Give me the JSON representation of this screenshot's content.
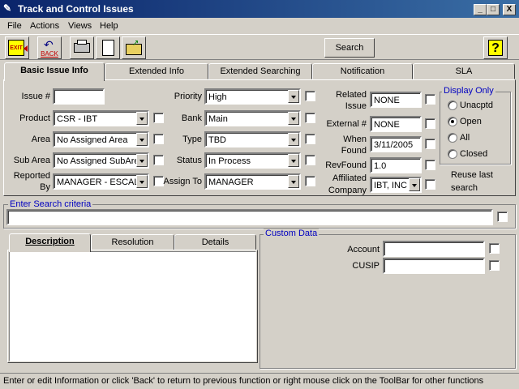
{
  "window": {
    "title": "Track and Control Issues",
    "minimize": "_",
    "maximize": "□",
    "close": "X"
  },
  "menu": [
    "File",
    "Actions",
    "Views",
    "Help"
  ],
  "toolbar": {
    "exit_label": "EXIT",
    "back_label": "BACK",
    "search_label": "Search",
    "help_label": "?"
  },
  "tabs": [
    "Basic Issue Info",
    "Extended Info",
    "Extended Searching",
    "Notification",
    "SLA"
  ],
  "form": {
    "issue_label": "Issue #",
    "issue_value": "",
    "product_label": "Product",
    "product_value": "CSR - IBT",
    "area_label": "Area",
    "area_value": "No Assigned Area",
    "subarea_label": "Sub Area",
    "subarea_value": "No Assigned SubArea",
    "reported_label_1": "Reported",
    "reported_label_2": "By",
    "reported_value": "MANAGER - ESCALA",
    "priority_label": "Priority",
    "priority_value": "High",
    "bank_label": "Bank",
    "bank_value": "Main",
    "type_label": "Type",
    "type_value": "TBD",
    "status_label": "Status",
    "status_value": "In Process",
    "assign_label": "Assign To",
    "assign_value": "MANAGER",
    "related_label_1": "Related",
    "related_label_2": "Issue",
    "related_value": "NONE",
    "external_label": "External #",
    "external_value": "NONE",
    "when_label_1": "When",
    "when_label_2": "Found",
    "when_value": "3/11/2005",
    "revfound_label": "RevFound",
    "revfound_value": "1.0",
    "affiliated_label_1": "Affiliated",
    "affiliated_label_2": "Company",
    "affiliated_value": "IBT, INC"
  },
  "display_only": {
    "title": "Display Only",
    "options": [
      "Unacptd",
      "Open",
      "All",
      "Closed"
    ],
    "selected": "Open"
  },
  "reuse": {
    "line1": "Reuse last",
    "line2": "search"
  },
  "search_criteria": {
    "title": "Enter Search criteria",
    "value": ""
  },
  "lower_tabs": [
    "Description",
    "Resolution",
    "Details"
  ],
  "custom_data": {
    "title": "Custom Data",
    "account_label": "Account",
    "cusip_label": "CUSIP"
  },
  "status": "Enter or edit Information or click 'Back' to return to previous function or right mouse click on the ToolBar for other functions"
}
